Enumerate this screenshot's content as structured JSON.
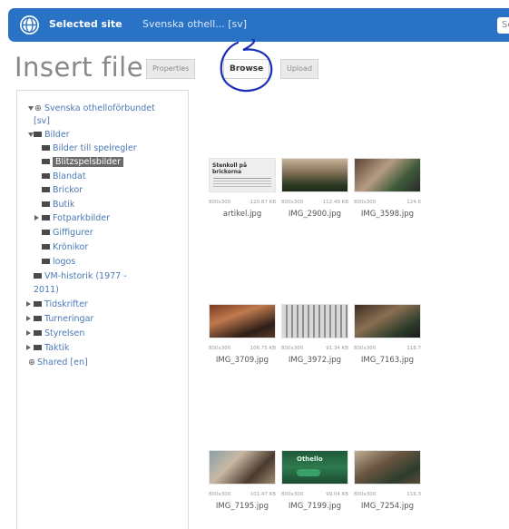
{
  "sitebar": {
    "label": "Selected site",
    "site_name": "Svenska othell... [sv]",
    "search_placeholder": "Se"
  },
  "header": {
    "title": "Insert file",
    "tabs": [
      {
        "label": "Properties",
        "active": false
      },
      {
        "label": "Browse",
        "active": true
      },
      {
        "label": "Upload",
        "active": false
      }
    ]
  },
  "tree": {
    "root_line1": "Svenska othelloförbundet",
    "root_line2": "[sv]",
    "nodes": [
      {
        "label": "Bilder"
      },
      {
        "label": "Bilder till spelregler"
      },
      {
        "label": "Blitzspelsbilder",
        "selected": true
      },
      {
        "label": "Blandat"
      },
      {
        "label": "Brickor"
      },
      {
        "label": "Butik"
      },
      {
        "label": "Fotparkbilder"
      },
      {
        "label": "Giffigurer"
      },
      {
        "label": "Krönikor"
      },
      {
        "label": "logos"
      },
      {
        "label": "VM-historik (1977 -"
      },
      {
        "label": "2011)"
      },
      {
        "label": "Tidskrifter"
      },
      {
        "label": "Turneringar"
      },
      {
        "label": "Styrelsen"
      },
      {
        "label": "Taktik"
      },
      {
        "label": "Shared [en]"
      }
    ]
  },
  "files": [
    {
      "name": "artikel.jpg",
      "dims": "800x300",
      "size": "120.87 KB",
      "caption": "Stenkoll på brickorna"
    },
    {
      "name": "IMG_2900.jpg",
      "dims": "800x300",
      "size": "112.49 KB"
    },
    {
      "name": "IMG_3598.jpg",
      "dims": "800x300",
      "size": "124.6"
    },
    {
      "name": "IMG_3709.jpg",
      "dims": "800x300",
      "size": "106.75 KB"
    },
    {
      "name": "IMG_3972.jpg",
      "dims": "800x300",
      "size": "91.34 KB"
    },
    {
      "name": "IMG_7163.jpg",
      "dims": "800x300",
      "size": "118.7"
    },
    {
      "name": "IMG_7195.jpg",
      "dims": "800x300",
      "size": "101.47 KB"
    },
    {
      "name": "IMG_7199.jpg",
      "dims": "800x300",
      "size": "99.04 KB",
      "caption": "Othello"
    },
    {
      "name": "IMG_7254.jpg",
      "dims": "800x300",
      "size": "116.3"
    }
  ]
}
